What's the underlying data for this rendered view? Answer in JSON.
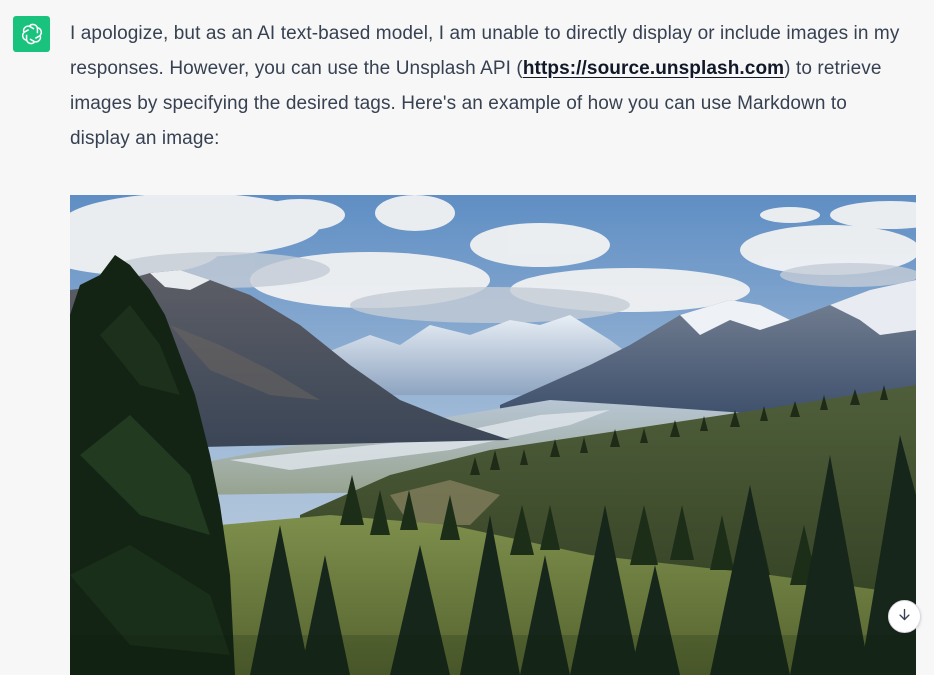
{
  "message": {
    "role": "assistant",
    "text_before_link": "I apologize, but as an AI text-based model, I am unable to directly display or include images in my responses. However, you can use the Unsplash API (",
    "link_text": "https://source.unsplash.com",
    "text_after_link": ") to retrieve images by specifying the desired tags. Here's an example of how you can use Markdown to display an image:"
  },
  "image": {
    "description": "mountain-landscape"
  },
  "icons": {
    "avatar": "openai-logo-icon",
    "scroll": "arrow-down-icon"
  },
  "colors": {
    "background": "#f7f7f8",
    "avatar_bg": "#19c37d",
    "text": "#374151",
    "link": "#111827"
  }
}
